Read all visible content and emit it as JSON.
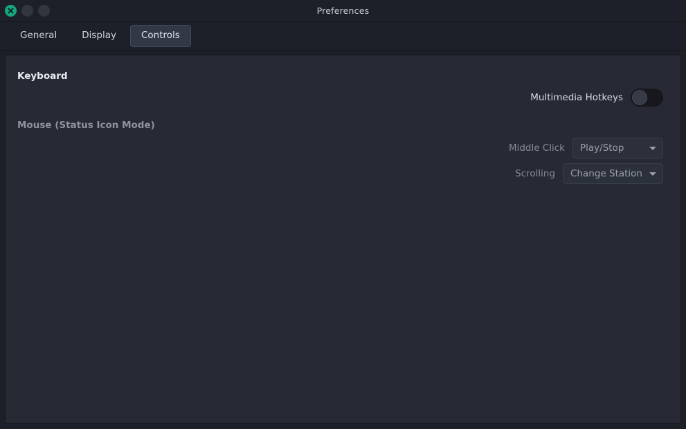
{
  "window": {
    "title": "Preferences",
    "controls": [
      {
        "name": "close",
        "icon": "close-x-icon",
        "color": "#15a87e"
      },
      {
        "name": "minimize",
        "icon": "minimize-icon",
        "color": "#32363f"
      },
      {
        "name": "maximize",
        "icon": "maximize-icon",
        "color": "#32363f"
      }
    ]
  },
  "tabs": [
    {
      "label": "General",
      "active": false
    },
    {
      "label": "Display",
      "active": false
    },
    {
      "label": "Controls",
      "active": true
    }
  ],
  "sections": [
    {
      "title": "Keyboard",
      "enabled": true,
      "rows": [
        {
          "label": "Multimedia Hotkeys",
          "control": "toggle",
          "value": "off",
          "enabled": true
        }
      ]
    },
    {
      "title": "Mouse (Status Icon Mode)",
      "enabled": false,
      "rows": [
        {
          "label": "Middle Click",
          "control": "dropdown",
          "value": "Play/Stop",
          "enabled": false
        },
        {
          "label": "Scrolling",
          "control": "dropdown",
          "value": "Change Station",
          "enabled": false
        }
      ]
    }
  ],
  "colors": {
    "accent": "#15a87e",
    "titlebar": "#1d2029",
    "content_bg": "#272a34",
    "window_bg": "#1c1f27",
    "text": "#e8ebf0",
    "text_disabled": "#868b95"
  }
}
